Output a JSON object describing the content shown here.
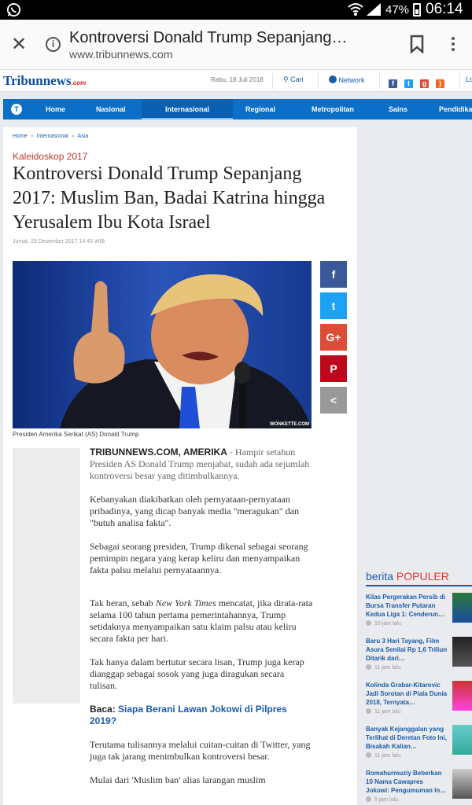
{
  "status": {
    "battery": "47%",
    "time": "06:14"
  },
  "browser": {
    "title": "Kontroversi Donald Trump Sepanjang…",
    "domain": "www.tribunnews.com"
  },
  "site": {
    "logo_main": "Tribunnews",
    "logo_suffix": ".com",
    "date": "Rabu, 18 Juli 2018",
    "search_label": "Cari",
    "network_label": "Network",
    "login_label": "Lo"
  },
  "nav": {
    "items": [
      "Home",
      "Nasional",
      "Internasional",
      "Regional",
      "Metropolitan",
      "Sains",
      "Pendidikan"
    ],
    "active": "Internasional"
  },
  "breadcrumb": [
    "Home",
    "Internasional",
    "Asia"
  ],
  "article": {
    "kicker": "Kaleidoskop 2017",
    "headline": "Kontroversi Donald Trump Sepanjang 2017: Muslim Ban, Badai Katrina hingga Yerusalem Ibu Kota Israel",
    "published": "Jumat, 29 Desember 2017 14:43 WIB",
    "photo_credit": "WONKETTE.COM",
    "caption": "Presiden Amerika Serikat (AS) Donald Trump",
    "lead_source": "TRIBUNNEWS.COM, AMERIKA",
    "lead_dash": " - ",
    "lead_text": "Hampir setahun Presiden AS Donald Trump menjabat, sudah ada sejumlah kontroversi besar yang ditimbulkannya.",
    "p2": "Kebanyakan diakibatkan oleh pernyataan-pernyataan pribadinya, yang dicap banyak media \"meragukan\" dan \"butuh analisa fakta\".",
    "p3": "Sebagai seorang presiden, Trump dikenal sebagai seorang pemimpin negara yang kerap keliru dan menyampaikan fakta palsu melalui pernyataannya.",
    "p4_a": "Tak heran, sebab ",
    "p4_em": "New York Times",
    "p4_b": " mencatat, jika dirata-rata selama 100 tahun pertama pemerintahannya, Trump setidaknya menyampaikan satu klaim palsu atau keliru secara fakta per hari.",
    "p5": "Tak hanya dalam bertutur secara lisan, Trump juga kerap dianggap sebagai sosok yang juga diragukan secara tulisan.",
    "baca_label": "Baca:",
    "baca_link": "Siapa Berani Lawan Jokowi di Pilpres 2019?",
    "p6": "Terutama tulisannya melalui cuitan-cuitan di Twitter, yang juga tak jarang menimbulkan kontroversi besar.",
    "p7": "Mulai dari 'Muslim ban' alias larangan muslim"
  },
  "share": {
    "facebook": "f",
    "twitter": "t",
    "googleplus": "G+",
    "pinterest": "P",
    "other": "<"
  },
  "popular": {
    "title_a": "berita",
    "title_b": "POPULER",
    "items": [
      {
        "title": "Kilas Pergerakan Persib di Bursa Transfer Putaran Kedua Liga 1: Cenderun…",
        "time": "10 jam lalu"
      },
      {
        "title": "Baru 3 Hari Tayang, Film Asura Senilai Rp 1,6 Triliun Ditarik dari…",
        "time": "11 jam lalu"
      },
      {
        "title": "Kolinda Grabar-Kitarovic Jadi Sorotan di Piala Dunia 2018, Ternyata…",
        "time": "11 jam lalu"
      },
      {
        "title": "Banyak Kejanggalan yang Terlihat di Deretan Foto Ini, Bisakah Kalian…",
        "time": "11 jam lalu"
      },
      {
        "title": "Romahurmuziy Beberkan 10 Nama Cawapres Jokowi: Pengumuman In…",
        "time": "9 jam lalu"
      }
    ]
  },
  "colors": {
    "nav_blue": "#0b6ec7",
    "facebook": "#3b5998",
    "twitter": "#1da1f2",
    "googleplus": "#dd4b39",
    "pinterest": "#bd081c",
    "share_other": "#999999"
  }
}
